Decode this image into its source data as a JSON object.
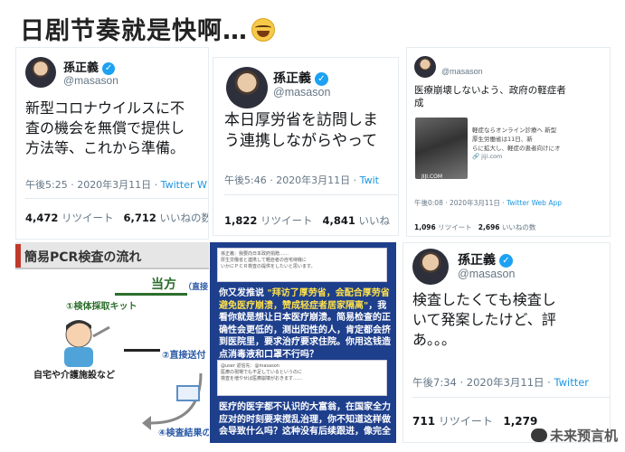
{
  "headline": "日剧节奏就是快啊…",
  "tweet1": {
    "name": "孫正義",
    "handle": "@masason",
    "lines": [
      "新型コロナウイルスに不",
      "査の機会を無償で提供し",
      "方法等、これから準備。"
    ],
    "time": "午後5:25 · 2020年3月11日 · ",
    "app": "Twitter W",
    "retweets": "4,472",
    "retweets_label": " リツイート",
    "likes": "6,712",
    "likes_label": " いいねの数"
  },
  "tweet2": {
    "name": "孫正義",
    "handle": "@masason",
    "lines": [
      "本日厚労省を訪問しま",
      "う連携しながらやって"
    ],
    "time": "午後5:46 · 2020年3月11日 · ",
    "app": "Twit",
    "retweets": "1,822",
    "retweets_label": " リツイート",
    "likes": "4,841",
    "likes_label": " いいね"
  },
  "tweet3": {
    "handle": "@masason",
    "lines": [
      "医療崩壊しないよう、政府の軽症者",
      "成"
    ],
    "thumb_label": "JIJI.COM",
    "thumb_text": [
      "軽症ならオンライン診療へ 新型",
      "厚生労働省は11日、新",
      "らに拡大し、軽症の患者向けにオ"
    ],
    "thumb_site": "jiji.com",
    "time": "午後0:08 · 2020年3月11日 · ",
    "app": "Twitter Web App",
    "retweets": "1,096",
    "retweets_label": " リツイート",
    "likes": "2,696",
    "likes_label": " いいねの数"
  },
  "tweet4": {
    "name": "孫正義",
    "handle": "@masason",
    "lines": [
      "検査したくても検査し",
      "いて発案したけど、評",
      "あ。。。"
    ],
    "time": "午後7:34 · 2020年3月11日 · ",
    "app": "Twitter",
    "retweets": "711",
    "retweets_label": " リツイート",
    "likes": "1,279"
  },
  "pcr": {
    "title": "簡易PCR検査の流れ",
    "side_label": "当方",
    "side_sub": "（直接",
    "step1": "①検体採取キット",
    "step2": "②直接送付",
    "step4": "④検査結果の",
    "caption": "自宅や介護施設など"
  },
  "zh": {
    "shot_top": [
      "孫正義：我要向日本政府捐赠……",
      "厚生労働省と連携して軽症者の自宅待機に",
      "いかにＰＣＲ検査の提供をしたいと思います。"
    ],
    "p1_pre": "你又发推说 ",
    "p1_em": "\"拜访了厚劳省，会配合厚劳省避免医疗崩溃，赞成轻症者居家隔离\"",
    "p1_post": "，我看你就是想让日本医疗崩溃。简易检查的正确性会更低的，测出阳性的人，肯定都会挤到医院里，要求治疗要求住院。你用这钱造点消毒液和口罩不行吗？",
    "shot_mid": [
      "@user 返信先：@masason",
      "医療の現場でも不足しているというのに",
      "検査を増やせば医療崩壊がおきます……"
    ],
    "p2": "医疗的医字都不认识的大富翁，在国家全力应对的时刻要来搅乱治理，你不知道这样做会导致什么吗？这种没有后续跟进，像完全"
  },
  "watermark": "未来预言机",
  "colors": {
    "verified": "#1da1f2",
    "zh_bg": "#1e3f8c",
    "zh_highlight": "#ffe14a",
    "link": "#1b95e0"
  }
}
